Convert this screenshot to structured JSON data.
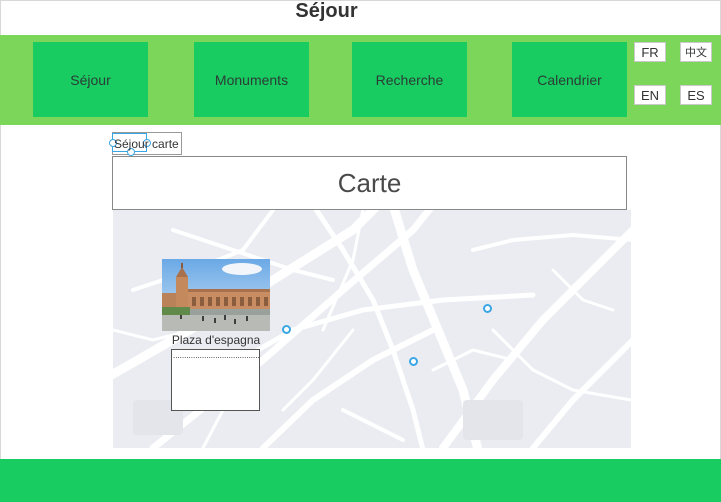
{
  "header": {
    "title": "Séjour"
  },
  "nav": {
    "items": [
      "Séjour",
      "Monuments",
      "Recherche",
      "Calendrier"
    ]
  },
  "languages": {
    "fr": "FR",
    "zh": "中文",
    "en": "EN",
    "es": "ES"
  },
  "breadcrumb": {
    "text": "Séjour carte"
  },
  "map": {
    "title": "Carte",
    "place": {
      "name": "Plaza d'espagna",
      "description": "................................................"
    }
  },
  "colors": {
    "nav_bar": "#7bd65a",
    "nav_button": "#18cc62",
    "footer": "#18cc62",
    "marker": "#39a6e6"
  }
}
